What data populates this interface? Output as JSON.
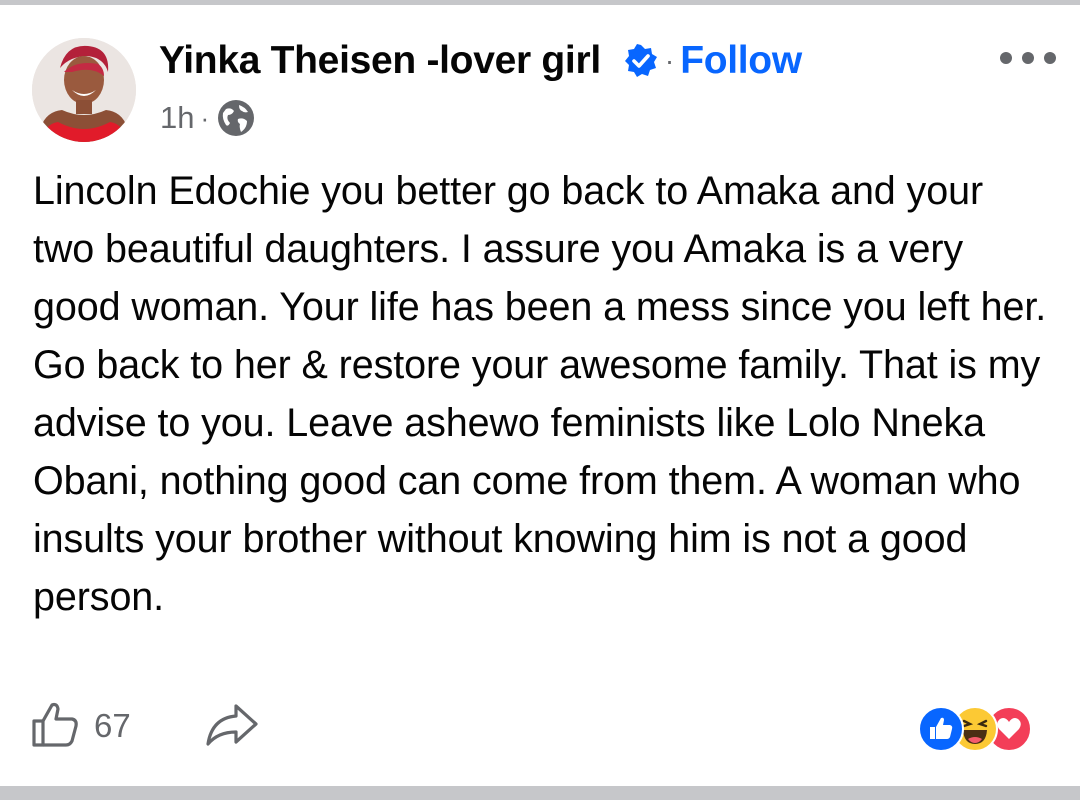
{
  "post": {
    "author_name": "Yinka Theisen -lover girl",
    "follow_label": "Follow",
    "timestamp": "1h",
    "separator": "·",
    "body": "Lincoln Edochie you better go back to Amaka and your two beautiful daughters. I assure you Amaka is a very good woman. Your life has been a mess since you left her. Go back to her & restore your awesome family. That is my advise to you. Leave ashewo feminists like Lolo Nneka Obani, nothing good can come from them. A woman who insults your brother without knowing him is not a good person.",
    "like_count": "67",
    "verified": true,
    "audience_icon": "globe-icon",
    "reactions": [
      "like-reaction-icon",
      "haha-reaction-icon",
      "love-reaction-icon"
    ]
  },
  "colors": {
    "text": "#050505",
    "secondary_text": "#65676b",
    "brand_blue": "#0866ff",
    "love_red": "#f33e58",
    "haha_yellow": "#fcc934",
    "divider": "#c6c7ca"
  }
}
